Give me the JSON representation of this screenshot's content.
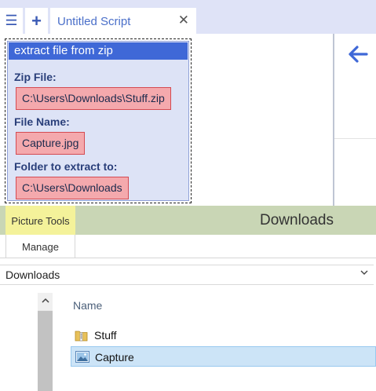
{
  "editor_tabs": {
    "menu_icon": "hamburger-icon",
    "add_icon": "plus-icon",
    "document_tab": {
      "title": "Untitled Script",
      "close_glyph": "✕"
    }
  },
  "script_block": {
    "header": "extract file from zip",
    "fields": [
      {
        "label": "Zip File:",
        "value": "C:\\Users\\Downloads\\Stuff.zip"
      },
      {
        "label": "File Name:",
        "value": "Capture.jpg"
      },
      {
        "label": "Folder to extract to:",
        "value": "C:\\Users\\Downloads"
      }
    ]
  },
  "right_pane": {
    "back_icon": "back-arrow-icon"
  },
  "explorer": {
    "contextual_tab_group": "Picture Tools",
    "window_title": "Downloads",
    "ribbon_tab": "Manage",
    "address": "Downloads",
    "column_header": "Name",
    "files": [
      {
        "name": "Stuff",
        "icon": "zip-folder-icon",
        "selected": false
      },
      {
        "name": "Capture",
        "icon": "image-file-icon",
        "selected": true
      }
    ]
  },
  "colors": {
    "block_header": "#3f68d7",
    "field_fill": "#f4a9ad",
    "ribbon_group": "#c9d6b5",
    "picture_tools": "#f4f29a",
    "selection": "#cce4f7"
  }
}
